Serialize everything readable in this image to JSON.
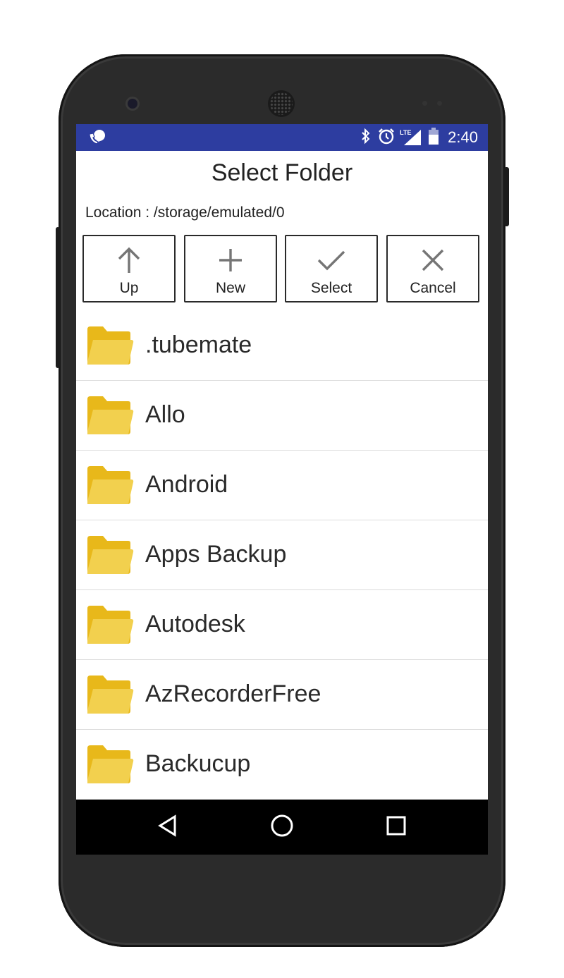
{
  "status_bar": {
    "time": "2:40",
    "network_label": "LTE",
    "icons": [
      "notification-chat-icon",
      "bluetooth-icon",
      "alarm-icon",
      "signal-icon",
      "battery-icon"
    ]
  },
  "dialog": {
    "title": "Select Folder",
    "location": "Location : /storage/emulated/0"
  },
  "actions": [
    {
      "label": "Up",
      "icon": "arrow-up-icon"
    },
    {
      "label": "New",
      "icon": "plus-icon"
    },
    {
      "label": "Select",
      "icon": "checkmark-icon"
    },
    {
      "label": "Cancel",
      "icon": "close-icon"
    }
  ],
  "folders": [
    ".tubemate",
    "Allo",
    "Android",
    "Apps Backup",
    "Autodesk",
    "AzRecorderFree",
    "Backucup"
  ],
  "colors": {
    "status_bar": "#2d3da0",
    "folder_dark": "#e8b81a",
    "folder_light": "#f2d04e",
    "icon_gray": "#757575"
  },
  "nav_bar": {
    "icons": [
      "back-icon",
      "home-icon",
      "recents-icon"
    ]
  }
}
